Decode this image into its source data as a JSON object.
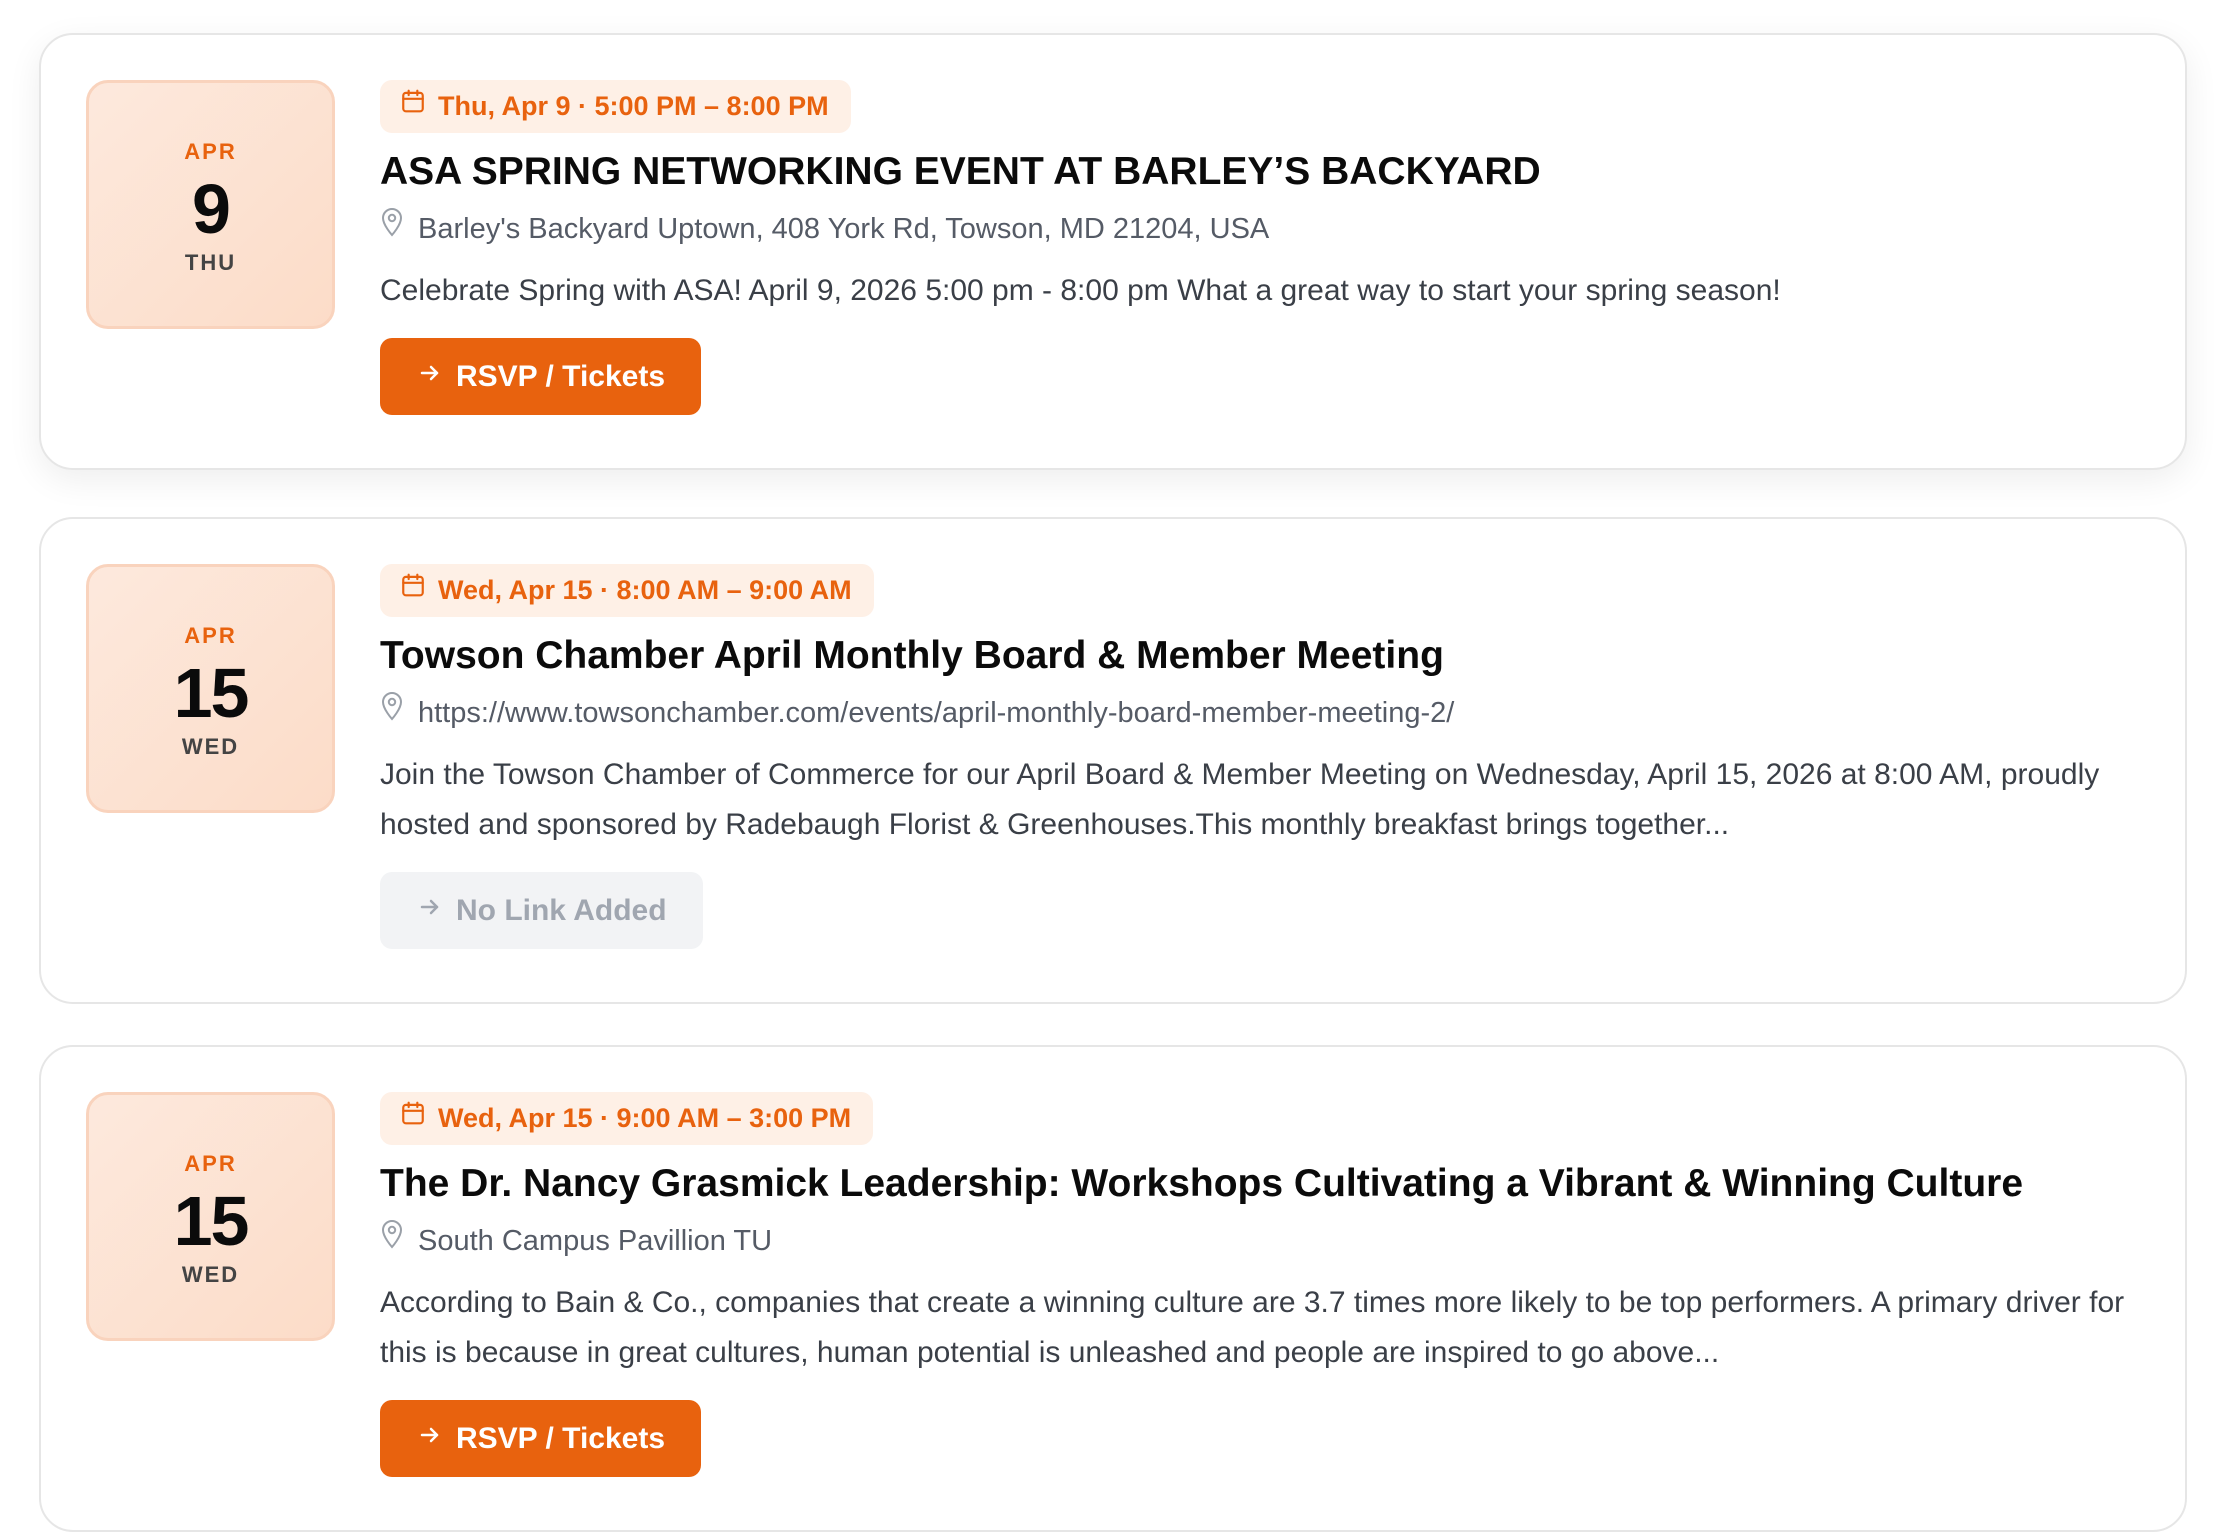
{
  "events": [
    {
      "date": {
        "month": "APR",
        "day": "9",
        "weekday": "THU"
      },
      "time": "Thu, Apr 9 · 5:00 PM – 8:00 PM",
      "title": "ASA SPRING NETWORKING EVENT AT BARLEY’S BACKYARD",
      "location": "Barley's Backyard Uptown, 408 York Rd, Towson, MD 21204, USA",
      "description": "Celebrate Spring with ASA! April 9, 2026 5:00 pm - 8:00 pm What a great way to start your spring season!",
      "button": {
        "label": "RSVP / Tickets",
        "enabled": true
      }
    },
    {
      "date": {
        "month": "APR",
        "day": "15",
        "weekday": "WED"
      },
      "time": "Wed, Apr 15 · 8:00 AM – 9:00 AM",
      "title": "Towson Chamber April Monthly Board & Member Meeting",
      "location": "https://www.towsonchamber.com/events/april-monthly-board-member-meeting-2/",
      "description": "Join the Towson Chamber of Commerce for our April Board & Member Meeting on Wednesday, April 15, 2026 at 8:00 AM, proudly hosted and sponsored by Radebaugh Florist & Greenhouses.This monthly breakfast brings together...",
      "button": {
        "label": "No Link Added",
        "enabled": false
      }
    },
    {
      "date": {
        "month": "APR",
        "day": "15",
        "weekday": "WED"
      },
      "time": "Wed, Apr 15 · 9:00 AM – 3:00 PM",
      "title": "The Dr. Nancy Grasmick Leadership: Workshops Cultivating a Vibrant & Winning Culture",
      "location": "South Campus Pavillion TU",
      "description": "According to Bain & Co., companies that create a winning culture are 3.7 times more likely to be top performers. A primary driver for this is because in great cultures, human potential is unleashed and people are inspired to go above...",
      "button": {
        "label": "RSVP / Tickets",
        "enabled": true
      }
    }
  ],
  "icons": {
    "time": "calendar-icon",
    "location": "map-pin-icon",
    "button": "arrow-right-icon"
  },
  "colors": {
    "accent": "#e8620e",
    "badge_bg": "#fef0e6",
    "date_box_bg": "#fde9dd",
    "disabled_bg": "#f2f3f5",
    "disabled_text": "#a0a6b0"
  }
}
